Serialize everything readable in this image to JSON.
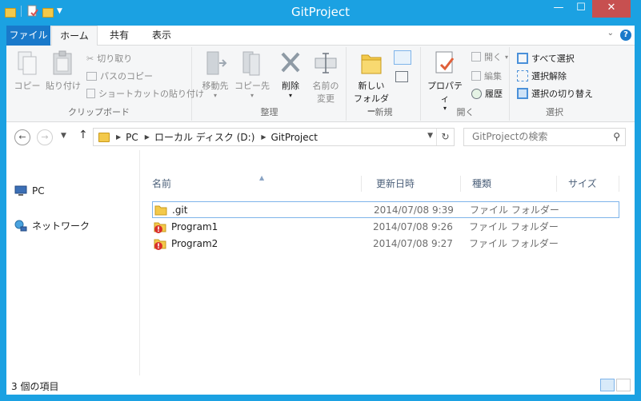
{
  "window": {
    "title": "GitProject",
    "controls": {
      "minimize": "—",
      "maximize": "☐",
      "close": "✕"
    },
    "accent_color": "#1ba1e2"
  },
  "ribbon_tabs": [
    {
      "label": "ファイル"
    },
    {
      "label": "ホーム"
    },
    {
      "label": "共有"
    },
    {
      "label": "表示"
    }
  ],
  "ribbon": {
    "clipboard": {
      "copy": "コピー",
      "paste": "貼り付け",
      "cut": "切り取り",
      "copy_path": "パスのコピー",
      "paste_shortcut": "ショートカットの貼り付け",
      "group": "クリップボード"
    },
    "organize": {
      "move_to": "移動先",
      "copy_to": "コピー先",
      "delete": "削除",
      "rename_line1": "名前の",
      "rename_line2": "変更",
      "group": "整理"
    },
    "new": {
      "new_folder_line1": "新しい",
      "new_folder_line2": "フォルダー",
      "group": "新規"
    },
    "open": {
      "properties": "プロパティ",
      "open": "開く",
      "edit": "編集",
      "history": "履歴",
      "group": "開く"
    },
    "select": {
      "select_all": "すべて選択",
      "select_none": "選択解除",
      "invert": "選択の切り替え",
      "group": "選択"
    }
  },
  "address": {
    "path": [
      "PC",
      "ローカル ディスク (D:)",
      "GitProject"
    ],
    "search_placeholder": "GitProjectの検索"
  },
  "nav_pane": [
    {
      "label": "PC"
    },
    {
      "label": "ネットワーク"
    }
  ],
  "columns": {
    "name": "名前",
    "date": "更新日時",
    "type": "種類",
    "size": "サイズ"
  },
  "files": [
    {
      "name": ".git",
      "date": "2014/07/08 9:39",
      "type": "ファイル フォルダー",
      "icon": "folder-icon"
    },
    {
      "name": "Program1",
      "date": "2014/07/08 9:26",
      "type": "ファイル フォルダー",
      "icon": "folder-warning-icon"
    },
    {
      "name": "Program2",
      "date": "2014/07/08 9:27",
      "type": "ファイル フォルダー",
      "icon": "folder-warning-icon"
    }
  ],
  "status": {
    "item_count": "3 個の項目"
  }
}
